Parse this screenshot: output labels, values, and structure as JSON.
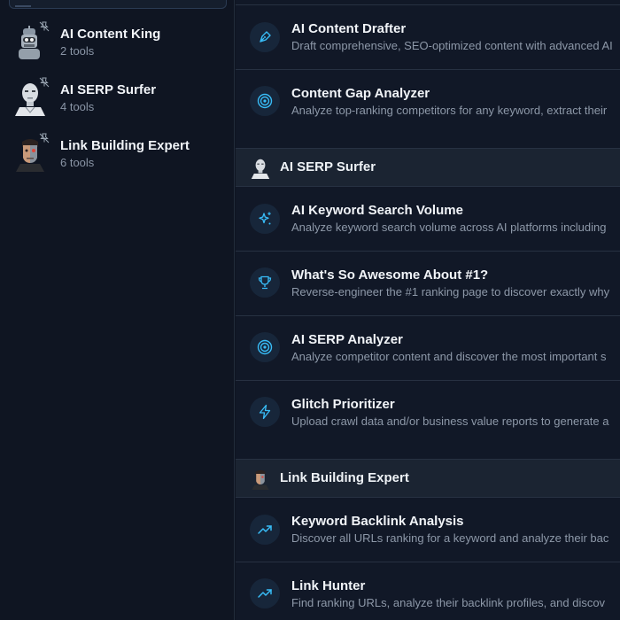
{
  "sidebar": {
    "agents": [
      {
        "name": "AI Content King",
        "count": "2 tools"
      },
      {
        "name": "AI SERP Surfer",
        "count": "4 tools"
      },
      {
        "name": "Link Building Expert",
        "count": "6 tools"
      }
    ]
  },
  "main": {
    "groups": [
      {
        "name": "AI Content King",
        "tools": [
          {
            "name": "AI Content Drafter",
            "desc": "Draft comprehensive, SEO-optimized content with advanced AI",
            "icon": "pen-nib-icon"
          },
          {
            "name": "Content Gap Analyzer",
            "desc": "Analyze top-ranking competitors for any keyword, extract their",
            "icon": "target-icon"
          }
        ]
      },
      {
        "name": "AI SERP Surfer",
        "tools": [
          {
            "name": "AI Keyword Search Volume",
            "desc": "Analyze keyword search volume across AI platforms including",
            "icon": "sparkles-icon"
          },
          {
            "name": "What's So Awesome About #1?",
            "desc": "Reverse-engineer the #1 ranking page to discover exactly why",
            "icon": "trophy-icon"
          },
          {
            "name": "AI SERP Analyzer",
            "desc": "Analyze competitor content and discover the most important s",
            "icon": "target-icon"
          },
          {
            "name": "Glitch Prioritizer",
            "desc": "Upload crawl data and/or business value reports to generate a",
            "icon": "lightning-icon"
          }
        ]
      },
      {
        "name": "Link Building Expert",
        "tools": [
          {
            "name": "Keyword Backlink Analysis",
            "desc": "Discover all URLs ranking for a keyword and analyze their bac",
            "icon": "trend-up-icon"
          },
          {
            "name": "Link Hunter",
            "desc": "Find ranking URLs, analyze their backlink profiles, and discov",
            "icon": "trend-up-icon"
          }
        ]
      }
    ]
  },
  "colors": {
    "accent": "#38bdf8",
    "background": "#0f1522",
    "panel": "#111827",
    "header": "#1b2432"
  }
}
